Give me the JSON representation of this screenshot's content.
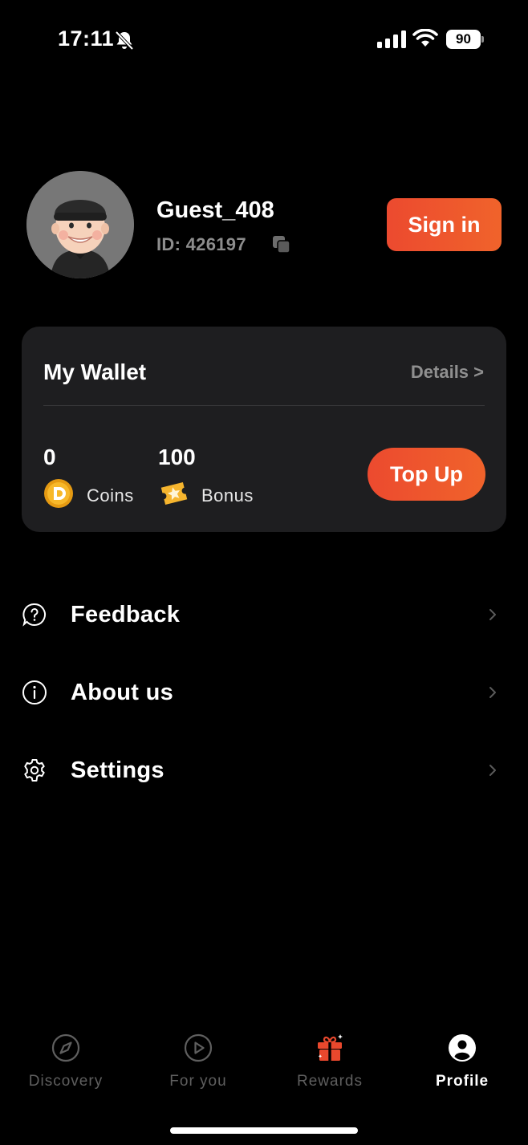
{
  "status_bar": {
    "time": "17:11",
    "battery": "90"
  },
  "profile": {
    "username": "Guest_408",
    "id_text": "ID: 426197",
    "signin_label": "Sign in"
  },
  "wallet": {
    "title": "My Wallet",
    "details_label": "Details >",
    "coins": {
      "value": "0",
      "label": "Coins"
    },
    "bonus": {
      "value": "100",
      "label": "Bonus"
    },
    "topup_label": "Top Up"
  },
  "menu": {
    "items": [
      {
        "label": "Feedback",
        "icon": "question-circle-icon"
      },
      {
        "label": "About us",
        "icon": "info-circle-icon"
      },
      {
        "label": "Settings",
        "icon": "gear-icon"
      }
    ]
  },
  "tabs": [
    {
      "label": "Discovery",
      "icon": "compass-icon",
      "active": false
    },
    {
      "label": "For you",
      "icon": "play-circle-icon",
      "active": false
    },
    {
      "label": "Rewards",
      "icon": "gift-icon",
      "active": false
    },
    {
      "label": "Profile",
      "icon": "user-circle-icon",
      "active": true
    }
  ],
  "colors": {
    "accent": "#ee5530",
    "card": "#1e1e20",
    "muted": "#8d8d8d",
    "background": "#000000"
  }
}
